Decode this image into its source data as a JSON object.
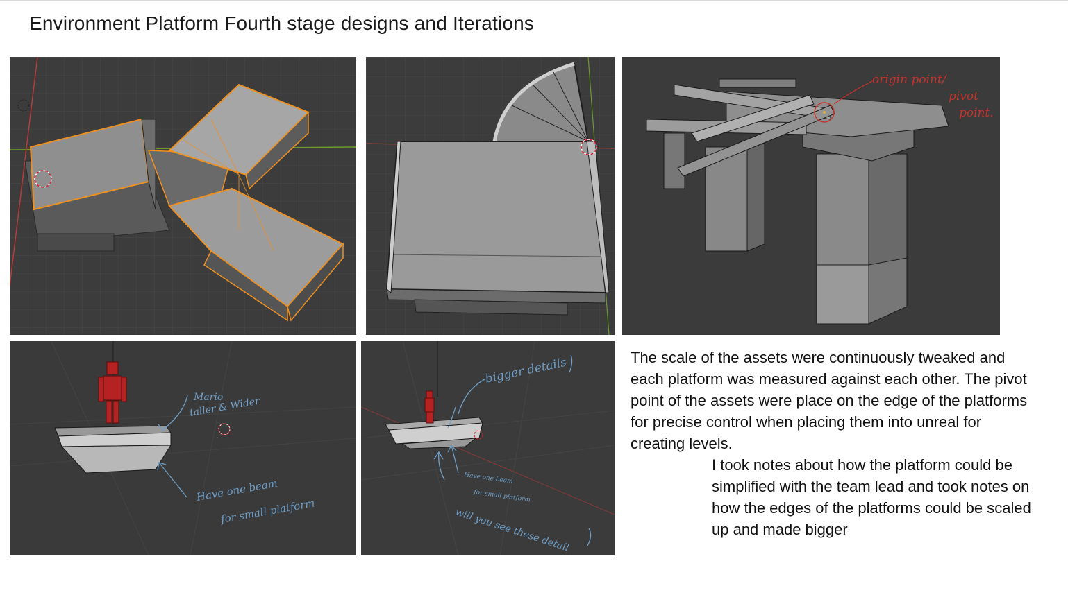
{
  "page": {
    "title": "Environment Platform Fourth stage designs and Iterations"
  },
  "panels": [
    {
      "name": "render-platform-y-shape-selected",
      "accent": "#f0901e"
    },
    {
      "name": "render-platform-square-with-curved-ramp",
      "accent": "#ffffff"
    },
    {
      "name": "render-platform-cross-beams-with-pillars",
      "annotation": [
        "origin point/",
        "pivot",
        "point."
      ],
      "annotation_color": "#c8322c"
    },
    {
      "name": "render-small-platform-with-figure",
      "annotation": [
        "Mario",
        "taller & Wider",
        "Have one beam",
        "for small platform"
      ],
      "annotation_color": "#6e9ec7",
      "figure_color": "#b52222"
    },
    {
      "name": "render-small-platform-far-view",
      "annotation": [
        "bigger details",
        "Have one beam",
        "for small platform",
        "will you see these detail"
      ],
      "annotation_color": "#6e9ec7",
      "figure_color": "#b52222"
    }
  ],
  "notes": {
    "paragraph_1": "The scale of the assets were continuously tweaked and each platform was measured against each other. The pivot point of the assets were place on the edge of the platforms for precise control when placing them into unreal for creating levels.",
    "paragraph_2": "I took notes about how the platform could be simplified with the team lead and took notes on how the edges of the platforms could be scaled up and made bigger"
  },
  "colors": {
    "viewport_bg": "#3c3c3c",
    "grid_line": "#4a4a4a",
    "axis_x": "#b83b3b",
    "axis_y": "#6a9a2a",
    "selection_orange": "#f0901e"
  }
}
